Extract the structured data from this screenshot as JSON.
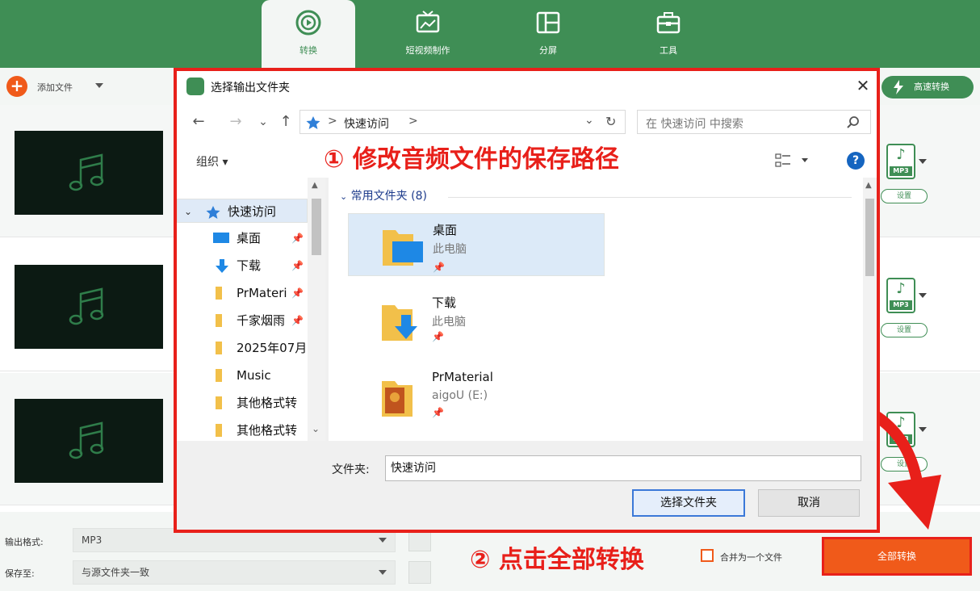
{
  "header": {
    "tabs": [
      {
        "label": "转换",
        "icon": "convert-icon",
        "active": true
      },
      {
        "label": "短视频制作",
        "icon": "short-video-icon",
        "active": false
      },
      {
        "label": "分屏",
        "icon": "split-screen-icon",
        "active": false
      },
      {
        "label": "工具",
        "icon": "toolbox-icon",
        "active": false
      }
    ],
    "accent_color": "#3f8e55"
  },
  "toolbar": {
    "add_file_label": "添加文件",
    "high_speed_label": "高速转换"
  },
  "file_rows": [
    {
      "format": "MP3",
      "settings_label": "设置"
    },
    {
      "format": "MP3",
      "settings_label": "设置"
    },
    {
      "format": "MP3",
      "settings_label": "设置"
    }
  ],
  "bottom": {
    "output_format_label": "输出格式:",
    "output_format_value": "MP3",
    "save_to_label": "保存至:",
    "save_to_value": "与源文件夹一致",
    "merge_label": "合并为一个文件",
    "convert_all_label": "全部转换",
    "convert_color": "#f05a1a"
  },
  "annotations": {
    "step1": "① 修改音频文件的保存路径",
    "step2": "② 点击全部转换",
    "highlight_color": "#e8201a"
  },
  "dialog": {
    "title": "选择输出文件夹",
    "close_glyph": "✕",
    "nav": {
      "back": "←",
      "forward": "→",
      "recent": "⌄",
      "up": "↑",
      "sep": ">",
      "refresh": "↻",
      "dropdown": "⌄"
    },
    "address_crumb": "快速访问",
    "search_placeholder": "在 快速访问 中搜索",
    "organize_label": "组织 ▾",
    "help_glyph": "?",
    "tree": [
      {
        "label": "快速访问",
        "icon": "quick-access-icon",
        "selected": true,
        "pinned": false
      },
      {
        "label": "桌面",
        "icon": "desktop-icon",
        "pinned": true
      },
      {
        "label": "下载",
        "icon": "download-icon",
        "pinned": true
      },
      {
        "label": "PrMateri",
        "icon": "folder-icon",
        "pinned": true
      },
      {
        "label": "千家烟雨",
        "icon": "folder-icon",
        "pinned": true
      },
      {
        "label": "2025年07月",
        "icon": "folder-icon",
        "pinned": false
      },
      {
        "label": "Music",
        "icon": "folder-icon",
        "pinned": false
      },
      {
        "label": "其他格式转",
        "icon": "folder-icon",
        "pinned": false
      },
      {
        "label": "其他格式转",
        "icon": "folder-icon",
        "pinned": false
      }
    ],
    "pin_glyph": "📌",
    "group_title": "常用文件夹 (8)",
    "files": [
      {
        "name": "桌面",
        "location": "此电脑",
        "icon": "desktop-folder-icon",
        "selected": true
      },
      {
        "name": "下载",
        "location": "此电脑",
        "icon": "download-folder-icon",
        "selected": false
      },
      {
        "name": "PrMaterial",
        "location": "aigoU (E:)",
        "icon": "image-folder-icon",
        "selected": false
      }
    ],
    "folder_field_label": "文件夹:",
    "folder_field_value": "快速访问",
    "select_button": "选择文件夹",
    "cancel_button": "取消"
  }
}
